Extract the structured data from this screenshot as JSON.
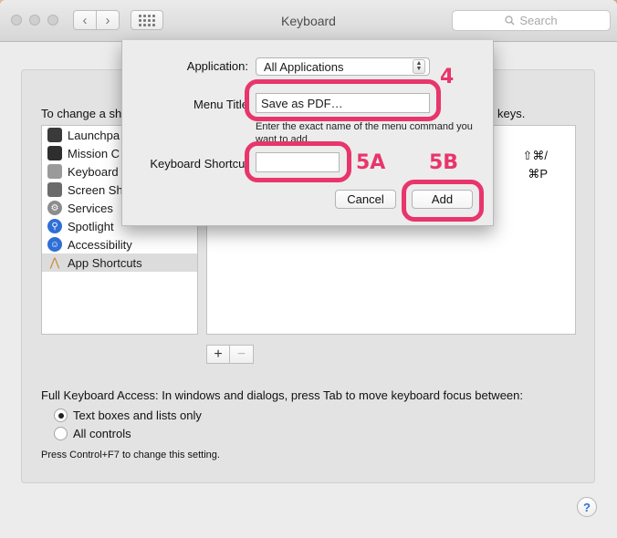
{
  "window": {
    "title": "Keyboard"
  },
  "toolbar": {
    "back": "‹",
    "forward": "›",
    "search_placeholder": "Search"
  },
  "pane": {
    "instruction": "To change a sh",
    "instruction_end": "keys.",
    "categories": [
      {
        "label": "Launchpa",
        "icon": "launchpad-icon",
        "color": "#3a3a3a"
      },
      {
        "label": "Mission C",
        "icon": "mission-control-icon",
        "color": "#2e2e2e"
      },
      {
        "label": "Keyboard",
        "icon": "keyboard-icon",
        "color": "#9a9a9a"
      },
      {
        "label": "Screen Sh",
        "icon": "screenshot-icon",
        "color": "#6b6b6b"
      },
      {
        "label": "Services",
        "icon": "gear-icon",
        "color": "#8c8c8c"
      },
      {
        "label": "Spotlight",
        "icon": "spotlight-icon",
        "color": "#2f6fd6"
      },
      {
        "label": "Accessibility",
        "icon": "accessibility-icon",
        "color": "#2f6fd6"
      },
      {
        "label": "App Shortcuts",
        "icon": "app-shortcuts-icon",
        "color": "#c98a3a"
      }
    ],
    "shortcut_keys": [
      "⇧⌘/",
      "⌘P"
    ],
    "add_label": "+",
    "remove_label": "−",
    "full_keyboard_access": "Full Keyboard Access: In windows and dialogs, press Tab to move keyboard focus between:",
    "radio_text_boxes": "Text boxes and lists only",
    "radio_all_controls": "All controls",
    "hint": "Press Control+F7 to change this setting.",
    "help": "?"
  },
  "sheet": {
    "application_label": "Application:",
    "application_value": "All Applications",
    "menu_title_label": "Menu Title",
    "menu_title_value": "Save as PDF…",
    "menu_hint": "Enter the exact name of the menu command you want to add.",
    "shortcut_label": "Keyboard Shortcut",
    "cancel": "Cancel",
    "add": "Add"
  },
  "annotations": {
    "step4": "4",
    "step5a": "5A",
    "step5b": "5B",
    "color": "#e8356b"
  }
}
